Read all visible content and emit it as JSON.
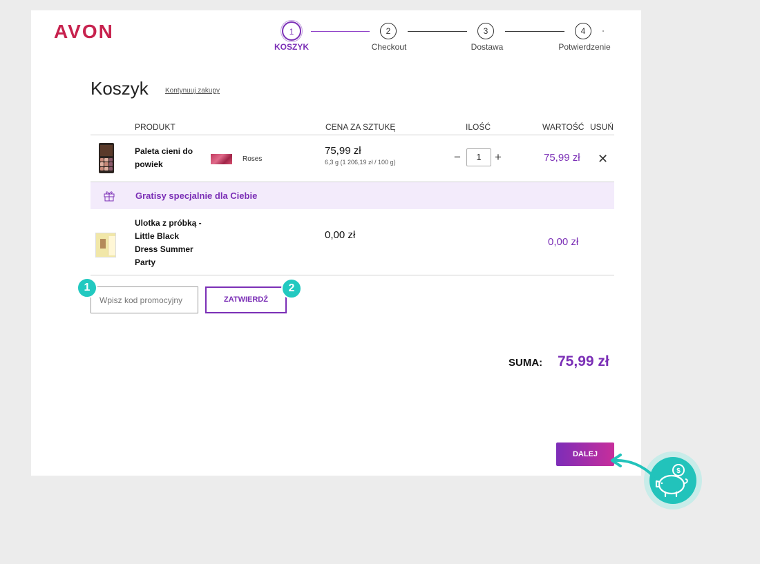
{
  "brand": {
    "name": "AVON",
    "color": "#c7224e"
  },
  "colors": {
    "accent": "#7b2fb6",
    "badge": "#22c9c0",
    "gift_bg": "#f3ebfb"
  },
  "stepper": {
    "steps": [
      {
        "number": "1",
        "label": "KOSZYK",
        "active": true
      },
      {
        "number": "2",
        "label": "Checkout",
        "active": false
      },
      {
        "number": "3",
        "label": "Dostawa",
        "active": false
      },
      {
        "number": "4",
        "label": "Potwierdzenie",
        "active": false
      }
    ]
  },
  "page": {
    "title": "Koszyk",
    "continue_link": "Kontynuuj zakupy"
  },
  "table": {
    "headers": {
      "product": "PRODUKT",
      "unit_price": "CENA ZA SZTUKĘ",
      "quantity": "ILOŚĆ",
      "value": "WARTOŚĆ",
      "remove": "USUŃ"
    }
  },
  "items": [
    {
      "name_line1": "Paleta cieni do",
      "name_line2": "powiek",
      "shade": "Roses",
      "price": "75,99 zł",
      "unit_price": "6,3 g (1 206,19 zł / 100 g)",
      "quantity": "1",
      "value": "75,99 zł"
    }
  ],
  "gifts": {
    "banner": "Gratisy specjalnie dla Ciebie",
    "items": [
      {
        "name_lines": [
          "Ulotka z próbką -",
          "Little Black",
          "Dress Summer",
          "Party"
        ],
        "price": "0,00 zł",
        "value": "0,00 zł"
      }
    ]
  },
  "promo": {
    "placeholder": "Wpisz kod promocyjny",
    "button_label": "ZATWIERDŹ"
  },
  "annotations": {
    "badge1": "1",
    "badge2": "2"
  },
  "summary": {
    "label": "SUMA:",
    "total": "75,99 zł"
  },
  "next_button": "DALEJ",
  "icons": {
    "minus": "−",
    "plus": "+",
    "remove": "✕",
    "gift": "gift-icon",
    "piggy": "piggy-bank-icon"
  }
}
